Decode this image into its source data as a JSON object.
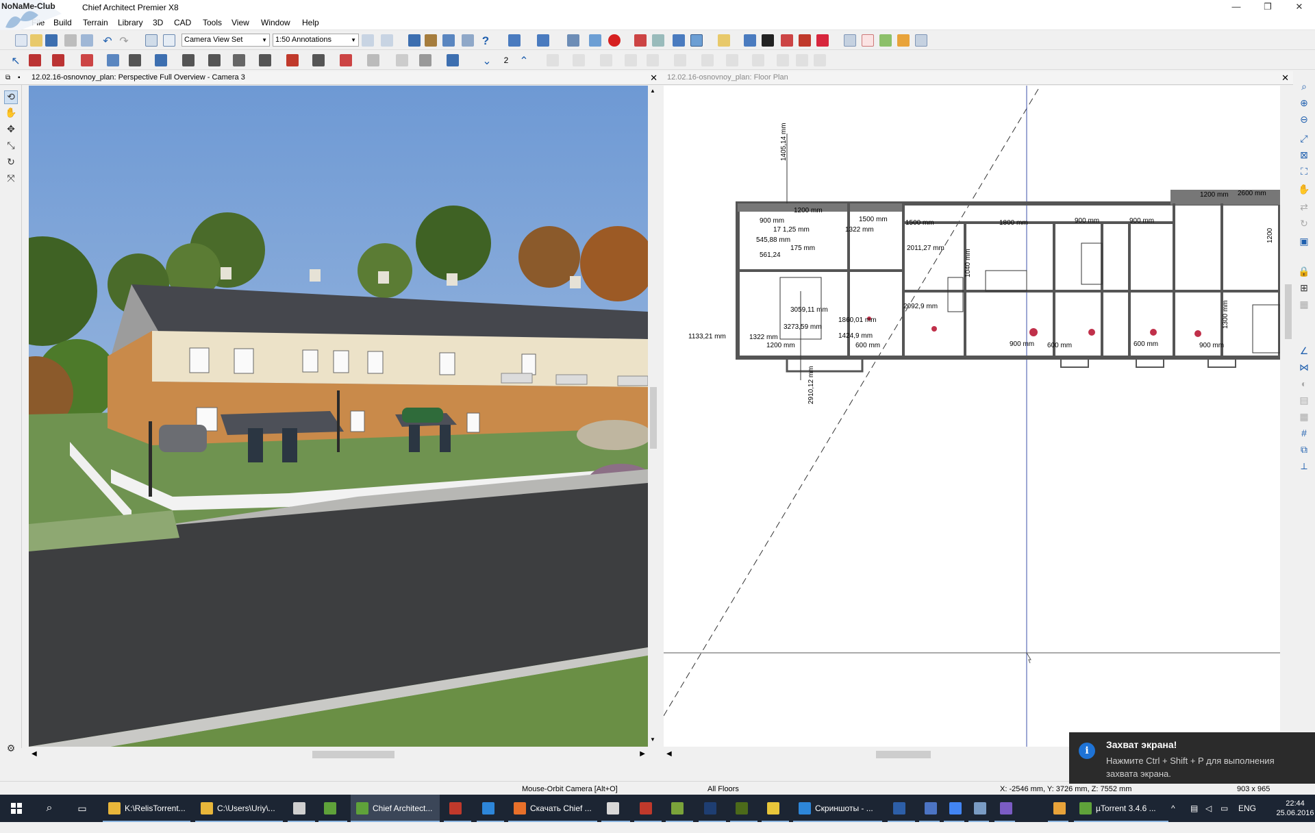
{
  "window": {
    "title": "Chief Architect Premier X8",
    "logo_text": "NoNaMe-Club",
    "minimize": "—",
    "restore": "❐",
    "close": "✕"
  },
  "menu": [
    "File",
    "Build",
    "Terrain",
    "Library",
    "3D",
    "CAD",
    "Tools",
    "View",
    "Window",
    "Help"
  ],
  "toolbar": {
    "camera_view_set": "Camera View Set",
    "annotation_set": "1:50 Annotations",
    "floor_number": "2"
  },
  "view3d": {
    "title": "12.02.16-osnovnoy_plan: Perspective Full Overview - Camera 3",
    "close": "✕"
  },
  "plan": {
    "title": "12.02.16-osnovnoy_plan: Floor Plan",
    "close": "✕",
    "dims": {
      "d1": "1405,14 mm",
      "d2": "1200 mm",
      "d3": "900 mm",
      "d4": "1500 mm",
      "d5": "17 1,25 mm",
      "d6": "1322 mm",
      "d7": "545,88 mm",
      "d8": "561,24",
      "d9": "175 mm",
      "d10": "2011,27 mm",
      "d11": "1500 mm",
      "d12": "1800 mm",
      "d13": "900 mm",
      "d14": "900 mm",
      "d15": "1200 mm",
      "d16": "2600 mm",
      "d17": "1133,21 mm",
      "d18": "3059,11 mm",
      "d19": "2092,9 mm",
      "d20": "1860,01 mm",
      "d21": "3273,59 mm",
      "d22": "1424,9 mm",
      "d23": "1322 mm",
      "d24": "1200 mm",
      "d25": "600 mm",
      "d26": "900 mm",
      "d27": "600 mm",
      "d28": "600 mm",
      "d29": "900 mm",
      "d30": "2910,12 mm",
      "d31": "1300 mm",
      "d32": "1200",
      "d33": "1040 mm"
    }
  },
  "status": {
    "mode": "Mouse-Orbit Camera [Alt+O]",
    "floors": "All Floors",
    "coords": "X: -2546 mm, Y: 3726 mm, Z: 7552 mm",
    "size": "903 x 965"
  },
  "toast": {
    "title": "Захват экрана!",
    "message": "Нажмите Ctrl + Shift + P для выполнения захвата экрана.",
    "icon": "info-icon"
  },
  "taskbar": {
    "items": [
      {
        "label": "K:\\RelisTorrent...",
        "color": "#e8b63a"
      },
      {
        "label": "C:\\Users\\Uriy\\...",
        "color": "#e8b63a"
      },
      {
        "label": "",
        "color": "#cfcfcf"
      },
      {
        "label": "",
        "color": "#5fa23a"
      },
      {
        "label": "Chief Architect...",
        "color": "#5fa23a"
      },
      {
        "label": "",
        "color": "#c0392b"
      },
      {
        "label": "",
        "color": "#2d86d9"
      },
      {
        "label": "Скачать Chief ...",
        "color": "#e8702a"
      },
      {
        "label": "",
        "color": "#d8d8d8"
      },
      {
        "label": "",
        "color": "#c0392b"
      },
      {
        "label": "",
        "color": "#7aa33a"
      },
      {
        "label": "",
        "color": "#1e3e72"
      },
      {
        "label": "",
        "color": "#4c6a1a"
      },
      {
        "label": "",
        "color": "#e8c63a"
      },
      {
        "label": "Скриншоты - ...",
        "color": "#2d86d9"
      },
      {
        "label": "",
        "color": "#2d5fa8"
      },
      {
        "label": "",
        "color": "#4c74c4"
      },
      {
        "label": "",
        "color": "#4285f4"
      },
      {
        "label": "",
        "color": "#7a9cc4"
      },
      {
        "label": "",
        "color": "#7b5cc4"
      },
      {
        "label": "",
        "color": "#e8a33a"
      },
      {
        "label": "µTorrent 3.4.6 ...",
        "color": "#5fa23a"
      }
    ],
    "lang": "ENG",
    "time": "22:44",
    "date": "25.06.2016"
  }
}
